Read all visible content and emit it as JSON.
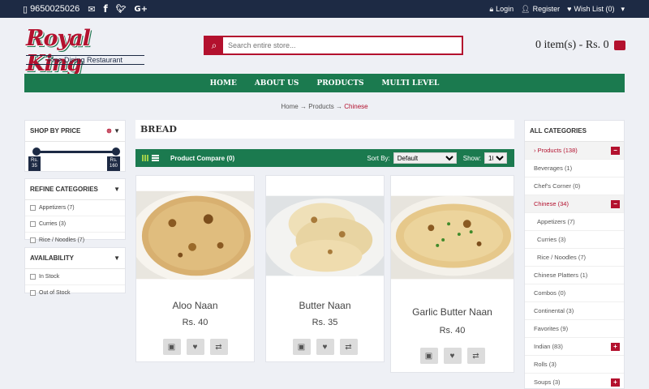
{
  "topbar": {
    "phone": "9650025026",
    "login": "Login",
    "register": "Register",
    "wishlist": "Wish List (0)"
  },
  "logo": {
    "title": "Royal King",
    "tagline": "Fine Dining Restaurant"
  },
  "search": {
    "placeholder": "Search entire store..."
  },
  "cart": {
    "label": "0 item(s) - Rs. 0"
  },
  "nav": [
    "HOME",
    "ABOUT US",
    "PRODUCTS",
    "MULTI LEVEL"
  ],
  "breadcrumb": {
    "home": "Home",
    "products": "Products",
    "current": "Chinese",
    "sep": "→"
  },
  "filters": {
    "price": {
      "title": "SHOP BY PRICE",
      "min": "Rs.\n35",
      "max": "Rs.\n160"
    },
    "refine": {
      "title": "REFINE CATEGORIES",
      "items": [
        "Appetizers (7)",
        "Curries (3)",
        "Rice / Noodles (7)"
      ]
    },
    "availability": {
      "title": "AVAILABILITY",
      "items": [
        "In Stock",
        "Out of Stock"
      ]
    }
  },
  "main": {
    "title": "BREAD",
    "compare": "Product Compare (0)",
    "sort_label": "Sort By:",
    "sort_value": "Default",
    "show_label": "Show:",
    "show_value": "100"
  },
  "products": [
    {
      "name": "Aloo Naan",
      "price": "Rs. 40"
    },
    {
      "name": "Butter Naan",
      "price": "Rs. 35"
    },
    {
      "name": "Garlic Butter Naan",
      "price": "Rs. 40"
    }
  ],
  "categories": {
    "title": "ALL CATEGORIES",
    "items": [
      {
        "label": "› Products (138)"
      },
      {
        "label": "Beverages (1)"
      },
      {
        "label": "Chef's Corner (0)"
      },
      {
        "label": "Chinese (34)"
      },
      {
        "label": "Appetizers (7)"
      },
      {
        "label": "Curries (3)"
      },
      {
        "label": "Rice / Noodles (7)"
      },
      {
        "label": "Chinese Platters (1)"
      },
      {
        "label": "Combos (0)"
      },
      {
        "label": "Continental (3)"
      },
      {
        "label": "Favorites (9)"
      },
      {
        "label": "Indian (83)"
      },
      {
        "label": "Rolls (3)"
      },
      {
        "label": "Soups (3)"
      }
    ],
    "minus": "−",
    "plus": "+"
  },
  "colors": {
    "brand_red": "#b3112e",
    "brand_green": "#1b7a4f",
    "topbar_navy": "#1d2a44"
  }
}
